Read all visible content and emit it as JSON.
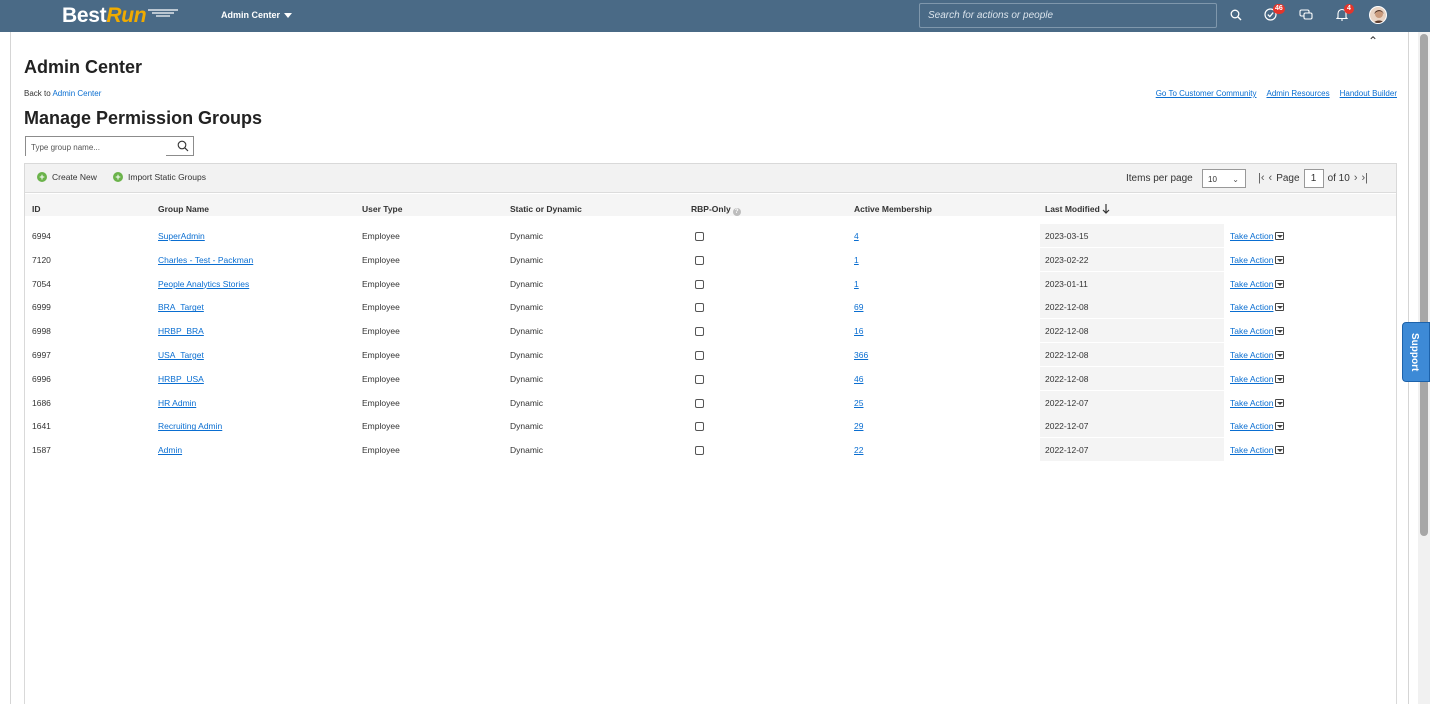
{
  "header": {
    "logo_best": "Best",
    "logo_run": "Run",
    "module": "Admin Center",
    "search_placeholder": "Search for actions or people",
    "todo_badge": "46",
    "notification_badge": "4"
  },
  "page": {
    "title": "Admin Center",
    "back_prefix": "Back to",
    "back_link": "Admin Center",
    "top_links": [
      "Go To Customer Community",
      "Admin Resources",
      "Handout Builder"
    ],
    "subtitle": "Manage Permission Groups",
    "filter_placeholder": "Type group name..."
  },
  "toolbar": {
    "create_new": "Create New",
    "import_static": "Import Static Groups",
    "items_per_page_label": "Items per page",
    "items_per_page_value": "10",
    "page_label": "Page",
    "page_current": "1",
    "page_total": "of 10"
  },
  "table": {
    "columns": {
      "id": "ID",
      "group_name": "Group Name",
      "user_type": "User Type",
      "static_dynamic": "Static or Dynamic",
      "rbp_only": "RBP-Only",
      "active_membership": "Active Membership",
      "last_modified": "Last Modified"
    },
    "take_action": "Take Action",
    "rows": [
      {
        "id": "6994",
        "name": "SuperAdmin",
        "user_type": "Employee",
        "kind": "Dynamic",
        "rbp": false,
        "membership": "4",
        "modified": "2023-03-15"
      },
      {
        "id": "7120",
        "name": "Charles - Test - Packman",
        "user_type": "Employee",
        "kind": "Dynamic",
        "rbp": false,
        "membership": "1",
        "modified": "2023-02-22"
      },
      {
        "id": "7054",
        "name": "People Analytics Stories",
        "user_type": "Employee",
        "kind": "Dynamic",
        "rbp": false,
        "membership": "1",
        "modified": "2023-01-11"
      },
      {
        "id": "6999",
        "name": "BRA_Target",
        "user_type": "Employee",
        "kind": "Dynamic",
        "rbp": false,
        "membership": "69",
        "modified": "2022-12-08"
      },
      {
        "id": "6998",
        "name": "HRBP_BRA",
        "user_type": "Employee",
        "kind": "Dynamic",
        "rbp": false,
        "membership": "16",
        "modified": "2022-12-08"
      },
      {
        "id": "6997",
        "name": "USA_Target",
        "user_type": "Employee",
        "kind": "Dynamic",
        "rbp": false,
        "membership": "366",
        "modified": "2022-12-08"
      },
      {
        "id": "6996",
        "name": "HRBP_USA",
        "user_type": "Employee",
        "kind": "Dynamic",
        "rbp": false,
        "membership": "46",
        "modified": "2022-12-08"
      },
      {
        "id": "1686",
        "name": "HR Admin",
        "user_type": "Employee",
        "kind": "Dynamic",
        "rbp": false,
        "membership": "25",
        "modified": "2022-12-07"
      },
      {
        "id": "1641",
        "name": "Recruiting Admin",
        "user_type": "Employee",
        "kind": "Dynamic",
        "rbp": false,
        "membership": "29",
        "modified": "2022-12-07"
      },
      {
        "id": "1587",
        "name": "Admin",
        "user_type": "Employee",
        "kind": "Dynamic",
        "rbp": false,
        "membership": "22",
        "modified": "2022-12-07"
      }
    ]
  },
  "support": {
    "label": "Support"
  },
  "colors": {
    "header_bg": "#4a6a86",
    "link": "#0a6ed1",
    "accent": "#f0ab00",
    "badge": "#e5352b",
    "support": "#3d8ad6"
  }
}
